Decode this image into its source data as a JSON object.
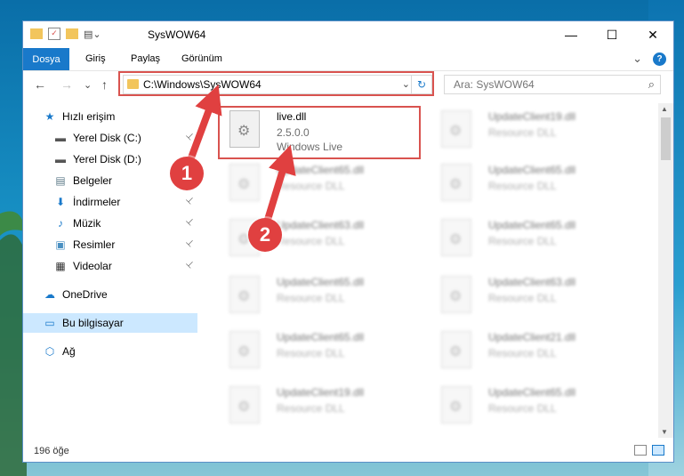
{
  "window": {
    "title": "SysWOW64",
    "controls": {
      "minimize": "—",
      "maximize": "☐",
      "close": "✕"
    }
  },
  "ribbon": {
    "file_tab": "Dosya",
    "tabs": [
      "Giriş",
      "Paylaş",
      "Görünüm"
    ],
    "expand": "⌄",
    "help": "?"
  },
  "nav": {
    "back": "←",
    "forward": "→",
    "recent": "⌄",
    "up": "↑",
    "address": "C:\\Windows\\SysWOW64",
    "address_dropdown": "⌄",
    "refresh": "↻",
    "search_placeholder": "Ara: SysWOW64",
    "search_icon": "⌕"
  },
  "sidebar": {
    "items": [
      {
        "label": "Hızlı erişim",
        "icon": "star-icon",
        "glyph": "★",
        "color": "#1979ca",
        "pinned": false,
        "indent": false
      },
      {
        "label": "Yerel Disk (C:)",
        "icon": "drive-c-icon",
        "glyph": "▬",
        "color": "#555",
        "pinned": true,
        "indent": true
      },
      {
        "label": "Yerel Disk (D:)",
        "icon": "drive-d-icon",
        "glyph": "▬",
        "color": "#555",
        "pinned": false,
        "indent": true
      },
      {
        "label": "Belgeler",
        "icon": "documents-icon",
        "glyph": "▤",
        "color": "#607d8b",
        "pinned": true,
        "indent": true
      },
      {
        "label": "İndirmeler",
        "icon": "downloads-icon",
        "glyph": "⬇",
        "color": "#1979ca",
        "pinned": true,
        "indent": true
      },
      {
        "label": "Müzik",
        "icon": "music-icon",
        "glyph": "♪",
        "color": "#1979ca",
        "pinned": true,
        "indent": true
      },
      {
        "label": "Resimler",
        "icon": "pictures-icon",
        "glyph": "▣",
        "color": "#4a90c2",
        "pinned": true,
        "indent": true
      },
      {
        "label": "Videolar",
        "icon": "videos-icon",
        "glyph": "▦",
        "color": "#333",
        "pinned": true,
        "indent": true
      },
      {
        "label": "OneDrive",
        "icon": "onedrive-icon",
        "glyph": "☁",
        "color": "#1979ca",
        "pinned": false,
        "indent": false
      },
      {
        "label": "Bu bilgisayar",
        "icon": "computer-icon",
        "glyph": "▭",
        "color": "#1979ca",
        "pinned": false,
        "indent": false,
        "selected": true
      },
      {
        "label": "Ağ",
        "icon": "network-icon",
        "glyph": "⬡",
        "color": "#1979ca",
        "pinned": false,
        "indent": false
      }
    ],
    "pin_glyph": "📌"
  },
  "files": {
    "highlighted": {
      "name": "live.dll",
      "version": "2.5.0.0",
      "product": "Windows Live"
    },
    "blurred": [
      {
        "name": "UpdateClient19.dll",
        "type": "Resource DLL"
      },
      {
        "name": "UpdateClient65.dll",
        "type": "Resource DLL"
      },
      {
        "name": "UpdateClient65.dll",
        "type": "Resource DLL"
      },
      {
        "name": "UpdateClient63.dll",
        "type": "Resource DLL"
      },
      {
        "name": "UpdateClient65.dll",
        "type": "Resource DLL"
      },
      {
        "name": "UpdateClient65.dll",
        "type": "Resource DLL"
      },
      {
        "name": "UpdateClient63.dll",
        "type": "Resource DLL"
      },
      {
        "name": "UpdateClient65.dll",
        "type": "Resource DLL"
      },
      {
        "name": "UpdateClient21.dll",
        "type": "Resource DLL"
      },
      {
        "name": "UpdateClient19.dll",
        "type": "Resource DLL"
      },
      {
        "name": "UpdateClient65.dll",
        "type": "Resource DLL"
      }
    ]
  },
  "status": {
    "item_count": "196 öğe"
  },
  "callouts": [
    "1",
    "2"
  ],
  "colors": {
    "accent": "#1979ca",
    "highlight": "#d9534f",
    "selected": "#cce8ff"
  }
}
